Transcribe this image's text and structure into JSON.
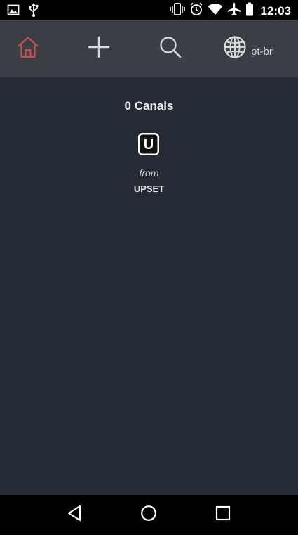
{
  "status_bar": {
    "time": "12:03",
    "icons_left": [
      "image-icon",
      "usb-icon"
    ],
    "icons_right": [
      "vibrate-icon",
      "alarm-icon",
      "wifi-icon",
      "airplane-icon",
      "battery-icon"
    ]
  },
  "toolbar": {
    "home_icon": "home-icon",
    "add_icon": "plus-icon",
    "search_icon": "search-icon",
    "language_icon": "globe-icon",
    "language_label": "pt-br",
    "active_color": "#c0504d"
  },
  "content": {
    "channels_title": "0 Canais",
    "from_label": "from",
    "brand_name": "UPSET",
    "brand_logo_letter": "U"
  },
  "nav_bar": {
    "back_icon": "back-triangle-icon",
    "home_icon": "home-circle-icon",
    "recents_icon": "recents-square-icon"
  },
  "colors": {
    "background": "#252b35",
    "toolbar": "#3b3e44",
    "accent": "#c0504d"
  }
}
